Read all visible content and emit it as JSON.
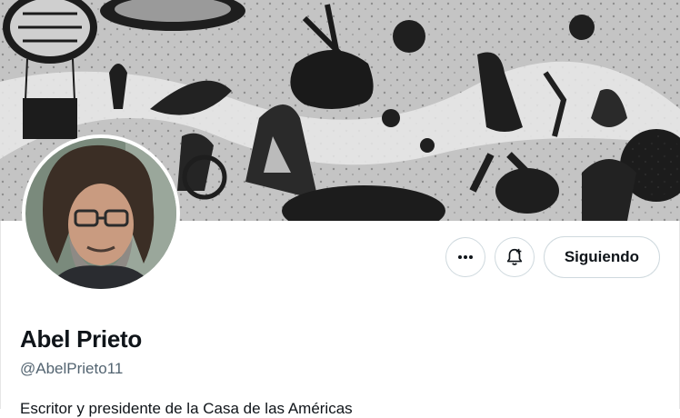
{
  "banner": {
    "icon": "illustrated-banner-art"
  },
  "avatar": {
    "icon": "profile-photo"
  },
  "actions": {
    "more_icon": "more-horizontal-icon",
    "more_label": "···",
    "notify_icon": "bell-plus-icon",
    "follow_label": "Siguiendo"
  },
  "profile": {
    "name": "Abel Prieto",
    "handle": "@AbelPrieto11",
    "bio": "Escritor y presidente de la Casa de las Américas"
  }
}
